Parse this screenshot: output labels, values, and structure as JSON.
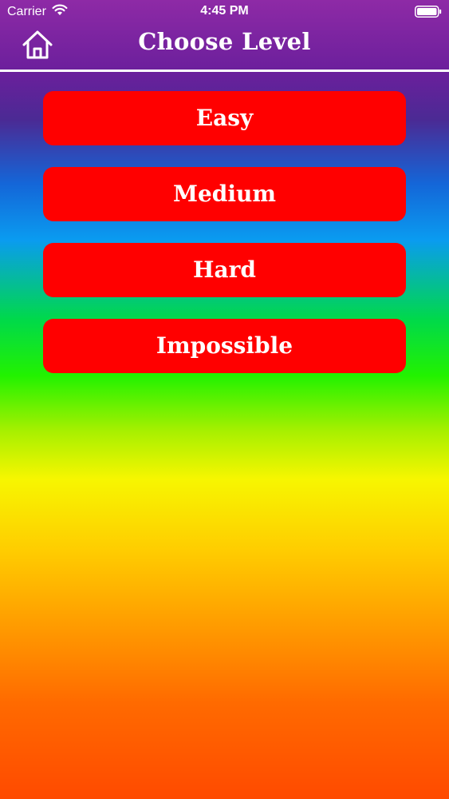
{
  "status_bar": {
    "carrier": "Carrier",
    "time": "4:45 PM"
  },
  "nav": {
    "title": "Choose Level"
  },
  "levels": [
    {
      "label": "Easy"
    },
    {
      "label": "Medium"
    },
    {
      "label": "Hard"
    },
    {
      "label": "Impossible"
    }
  ],
  "colors": {
    "button": "#ff0000",
    "text": "#ffffff"
  }
}
